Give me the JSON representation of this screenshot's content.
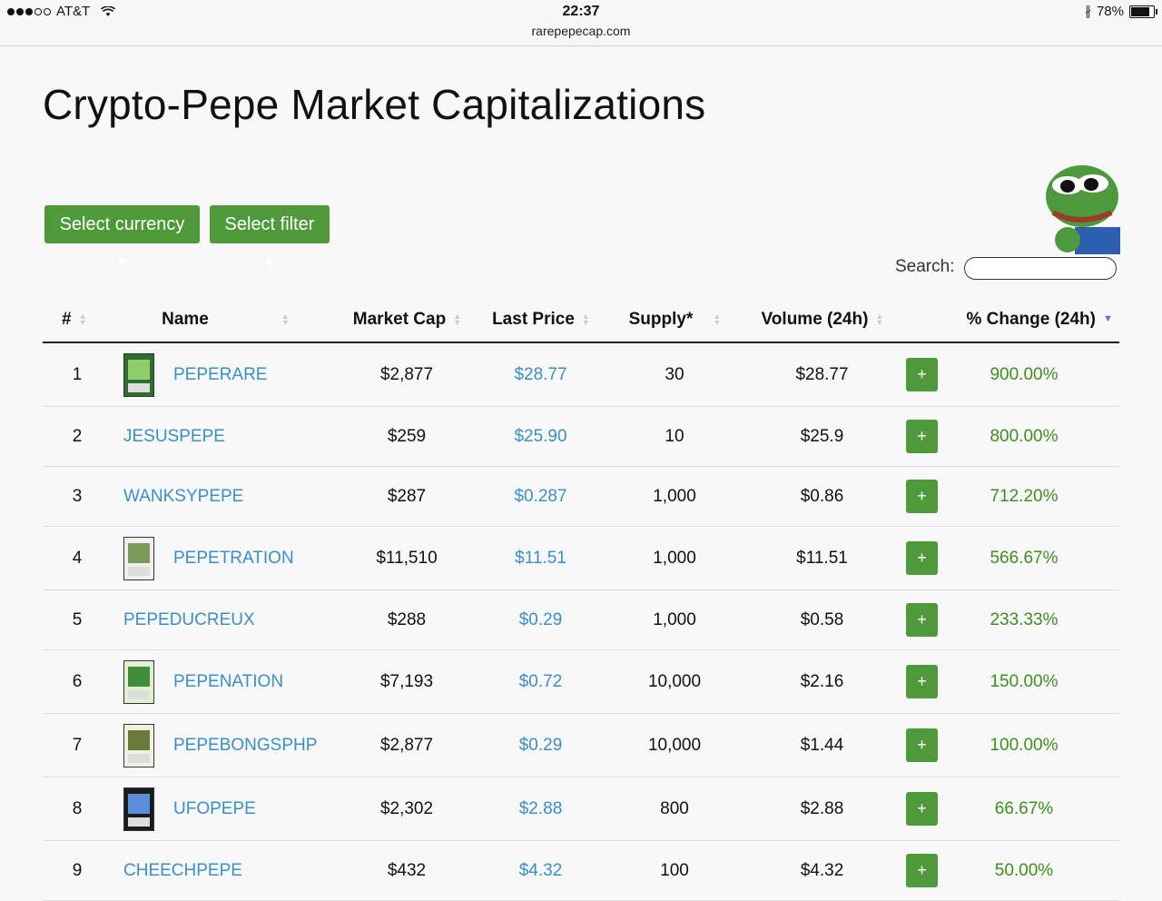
{
  "status": {
    "carrier": "AT&T",
    "time": "22:37",
    "url": "rarepepecap.com",
    "battery": "78%"
  },
  "page_title": "Crypto-Pepe Market Capitalizations",
  "buttons": {
    "currency": "Select currency ▾",
    "filter": "Select filter ▾"
  },
  "search": {
    "label": "Search:",
    "value": ""
  },
  "table": {
    "headers": [
      "#",
      "Name",
      "Market Cap",
      "Last Price",
      "Supply*",
      "Volume (24h)",
      "% Change (24h)"
    ],
    "sorted_column": "% Change (24h)",
    "sort_direction": "descending",
    "rows": [
      {
        "rank": "1",
        "name": "PEPERARE",
        "has_image": true,
        "market_cap": "$2,877",
        "last_price": "$28.77",
        "supply": "30",
        "volume": "$28.77",
        "change": "900.00%"
      },
      {
        "rank": "2",
        "name": "JESUSPEPE",
        "has_image": false,
        "market_cap": "$259",
        "last_price": "$25.90",
        "supply": "10",
        "volume": "$25.9",
        "change": "800.00%"
      },
      {
        "rank": "3",
        "name": "WANKSYPEPE",
        "has_image": false,
        "market_cap": "$287",
        "last_price": "$0.287",
        "supply": "1,000",
        "volume": "$0.86",
        "change": "712.20%"
      },
      {
        "rank": "4",
        "name": "PEPETRATION",
        "has_image": true,
        "market_cap": "$11,510",
        "last_price": "$11.51",
        "supply": "1,000",
        "volume": "$11.51",
        "change": "566.67%"
      },
      {
        "rank": "5",
        "name": "PEPEDUCREUX",
        "has_image": false,
        "market_cap": "$288",
        "last_price": "$0.29",
        "supply": "1,000",
        "volume": "$0.58",
        "change": "233.33%"
      },
      {
        "rank": "6",
        "name": "PEPENATION",
        "has_image": true,
        "market_cap": "$7,193",
        "last_price": "$0.72",
        "supply": "10,000",
        "volume": "$2.16",
        "change": "150.00%"
      },
      {
        "rank": "7",
        "name": "PEPEBONGSPHP",
        "has_image": true,
        "market_cap": "$2,877",
        "last_price": "$0.29",
        "supply": "10,000",
        "volume": "$1.44",
        "change": "100.00%"
      },
      {
        "rank": "8",
        "name": "UFOPEPE",
        "has_image": true,
        "market_cap": "$2,302",
        "last_price": "$2.88",
        "supply": "800",
        "volume": "$2.88",
        "change": "66.67%"
      },
      {
        "rank": "9",
        "name": "CHEECHPEPE",
        "has_image": false,
        "market_cap": "$432",
        "last_price": "$4.32",
        "supply": "100",
        "volume": "$4.32",
        "change": "50.00%"
      }
    ],
    "action_label": "+"
  },
  "colors": {
    "accent_green": "#4e9a3a",
    "link_blue": "#3a8fc9",
    "change_green": "#3f8f1f"
  }
}
